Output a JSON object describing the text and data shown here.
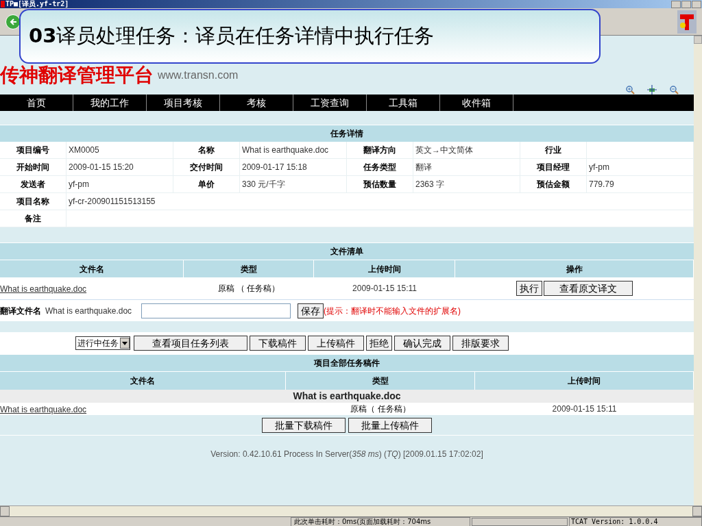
{
  "window": {
    "title": "TP■[译员.yf-tr2]"
  },
  "callout": {
    "number": "03",
    "text": "译员处理任务：译员在任务详情中执行任务"
  },
  "logo": {
    "name": "传神翻译管理平台",
    "url": "www.transn.com"
  },
  "nav": [
    "首页",
    "我的工作",
    "项目考核",
    "考核",
    "工资查询",
    "工具箱",
    "收件箱"
  ],
  "task_details": {
    "title": "任务详情",
    "rows": [
      [
        {
          "label": "项目编号",
          "value": "XM0005"
        },
        {
          "label": "名称",
          "value": "What is earthquake.doc"
        },
        {
          "label": "翻译方向",
          "value": "英文→中文简体"
        },
        {
          "label": "行业"
        }
      ],
      [
        {
          "label": "开始时间",
          "value": "2009-01-15 15:20"
        },
        {
          "label": "交付时间",
          "value": "2009-01-17 15:18"
        },
        {
          "label": "任务类型",
          "value": "翻译"
        },
        {
          "label": "项目经理",
          "value": "yf-pm"
        }
      ],
      [
        {
          "label": "发送者",
          "value": "yf-pm"
        },
        {
          "label": "单价",
          "value": "330 元/千字"
        },
        {
          "label": "预估数量",
          "value": "2363 字"
        },
        {
          "label": "预估金额",
          "value": "779.79"
        }
      ],
      [
        {
          "label": "项目名称",
          "value": "yf-cr-200901151513155"
        }
      ],
      [
        {
          "label": "备注"
        }
      ]
    ]
  },
  "file_list": {
    "title": "文件清单",
    "columns": [
      "文件名",
      "类型",
      "上传时间",
      "操作"
    ],
    "rows": [
      {
        "file": "What is earthquake.doc",
        "type": "原稿 （ 任务稿）",
        "time": "2009-01-15 15:11",
        "actions": [
          "执行",
          "查看原文译文"
        ]
      }
    ],
    "translated_name": {
      "label": "翻译文件名",
      "source": "What is earthquake.doc",
      "save": "保存",
      "hint": "(提示：翻译时不能输入文件的扩展名)"
    }
  },
  "task_actions": {
    "status_select": "进行中任务",
    "buttons": [
      "查看项目任务列表",
      "下载稿件",
      "上传稿件",
      "拒绝",
      "确认完成",
      "排版要求"
    ]
  },
  "all_files": {
    "title": "项目全部任务稿件",
    "columns": [
      "文件名",
      "类型",
      "上传时间"
    ],
    "group": "What is earthquake.doc",
    "rows": [
      {
        "file": "What is earthquake.doc",
        "type": "原稿（ 任务稿）",
        "time": "2009-01-15 15:11"
      }
    ],
    "buttons": [
      "批量下载稿件",
      "批量上传稿件"
    ]
  },
  "version": "Version: 0.42.10.61 Process In Server(*358 ms*) (*TQ*) [2009.01.15 17:02:02]",
  "status_bar": [
    "此次单击耗时：0ms(页面加载耗时：704ms",
    "TCAT Version: 1.0.0.4"
  ]
}
